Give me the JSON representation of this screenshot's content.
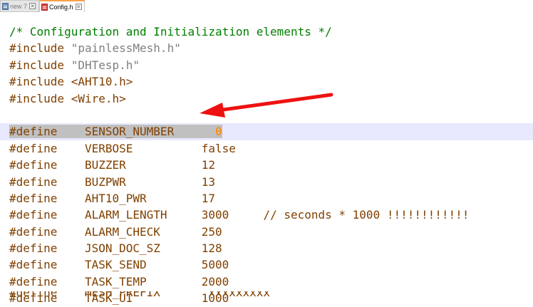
{
  "tabs": [
    {
      "label": "new 7",
      "active": false,
      "icon": "file-icon",
      "color": "#6f8fb8"
    },
    {
      "label": "Config.h",
      "active": true,
      "icon": "file-modified-icon",
      "color": "#d94a4a"
    }
  ],
  "code": {
    "comment_line": "/* Configuration and Initialization elements */",
    "includes": [
      {
        "directive": "#include",
        "target": "\"painlessMesh.h\""
      },
      {
        "directive": "#include",
        "target": "\"DHTesp.h\""
      },
      {
        "directive": "#include",
        "target": "<AHT10.h>"
      },
      {
        "directive": "#include",
        "target": "<Wire.h>"
      }
    ],
    "defines": [
      {
        "directive": "#define",
        "name": "SENSOR_NUMBER",
        "value": "0",
        "comment": ""
      },
      {
        "directive": "#define",
        "name": "VERBOSE",
        "value": "false",
        "comment": ""
      },
      {
        "directive": "#define",
        "name": "BUZZER",
        "value": "12",
        "comment": ""
      },
      {
        "directive": "#define",
        "name": "BUZPWR",
        "value": "13",
        "comment": ""
      },
      {
        "directive": "#define",
        "name": "AHT10_PWR",
        "value": "17",
        "comment": ""
      },
      {
        "directive": "#define",
        "name": "ALARM_LENGTH",
        "value": "3000",
        "comment": "// seconds * 1000 !!!!!!!!!!!!"
      },
      {
        "directive": "#define",
        "name": "ALARM_CHECK",
        "value": "250",
        "comment": ""
      },
      {
        "directive": "#define",
        "name": "JSON_DOC_SZ",
        "value": "128",
        "comment": ""
      },
      {
        "directive": "#define",
        "name": "TASK_SEND",
        "value": "5000",
        "comment": ""
      },
      {
        "directive": "#define",
        "name": "TASK_TEMP",
        "value": "2000",
        "comment": ""
      },
      {
        "directive": "#define",
        "name": "TASK_UI",
        "value": "1000",
        "comment": ""
      }
    ],
    "partial_line": "#define    MESH_PREFIX      \"xxxxxxxxx\""
  },
  "colors": {
    "comment": "#007f00",
    "preprocessor": "#804000",
    "string": "#808080",
    "number": "#ff8000",
    "current_line": "#e8e8ff",
    "selection": "#c0c0c0",
    "annotation_arrow": "#ee1111"
  }
}
